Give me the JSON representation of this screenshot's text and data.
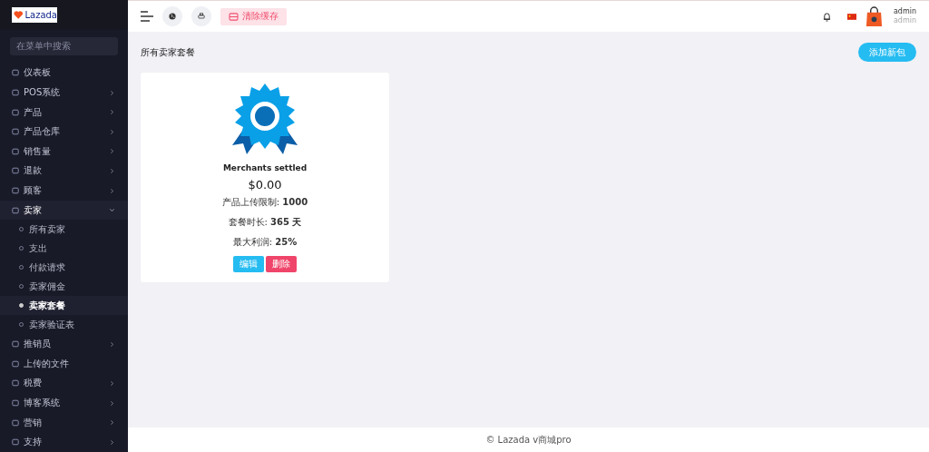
{
  "logo": {
    "text": "Lazada"
  },
  "sidebar": {
    "search": {
      "placeholder": "在菜单中搜索"
    },
    "items": [
      {
        "label": "仪表板",
        "has_children": false,
        "expanded": false
      },
      {
        "label": "POS系统",
        "has_children": true,
        "expanded": false
      },
      {
        "label": "产品",
        "has_children": true,
        "expanded": false
      },
      {
        "label": "产品仓库",
        "has_children": true,
        "expanded": false
      },
      {
        "label": "销售量",
        "has_children": true,
        "expanded": false
      },
      {
        "label": "退款",
        "has_children": true,
        "expanded": false
      },
      {
        "label": "顾客",
        "has_children": true,
        "expanded": false
      },
      {
        "label": "卖家",
        "has_children": true,
        "expanded": true,
        "children": [
          {
            "label": "所有卖家",
            "selected": false
          },
          {
            "label": "支出",
            "selected": false
          },
          {
            "label": "付款请求",
            "selected": false
          },
          {
            "label": "卖家佣金",
            "selected": false
          },
          {
            "label": "卖家套餐",
            "selected": true
          },
          {
            "label": "卖家验证表",
            "selected": false
          }
        ]
      },
      {
        "label": "推销员",
        "has_children": true,
        "expanded": false
      },
      {
        "label": "上传的文件",
        "has_children": false,
        "expanded": false
      },
      {
        "label": "税费",
        "has_children": true,
        "expanded": false
      },
      {
        "label": "博客系统",
        "has_children": true,
        "expanded": false
      },
      {
        "label": "营销",
        "has_children": true,
        "expanded": false
      },
      {
        "label": "支持",
        "has_children": true,
        "expanded": false
      }
    ]
  },
  "topbar": {
    "clear_cache": "清除缓存",
    "user": {
      "name": "admin",
      "role": "admin"
    }
  },
  "page": {
    "title": "所有卖家套餐",
    "add_button": "添加新包",
    "packages": [
      {
        "name": "Merchants settled",
        "price": "$0.00",
        "lines": [
          {
            "label": "产品上传限制: ",
            "value": "1000"
          },
          {
            "label": "套餐时长: ",
            "value": "365 天"
          },
          {
            "label": "最大利润: ",
            "value": "25%"
          }
        ],
        "edit": "编辑",
        "delete": "删除"
      }
    ]
  },
  "footer": "© Lazada v商城pro"
}
